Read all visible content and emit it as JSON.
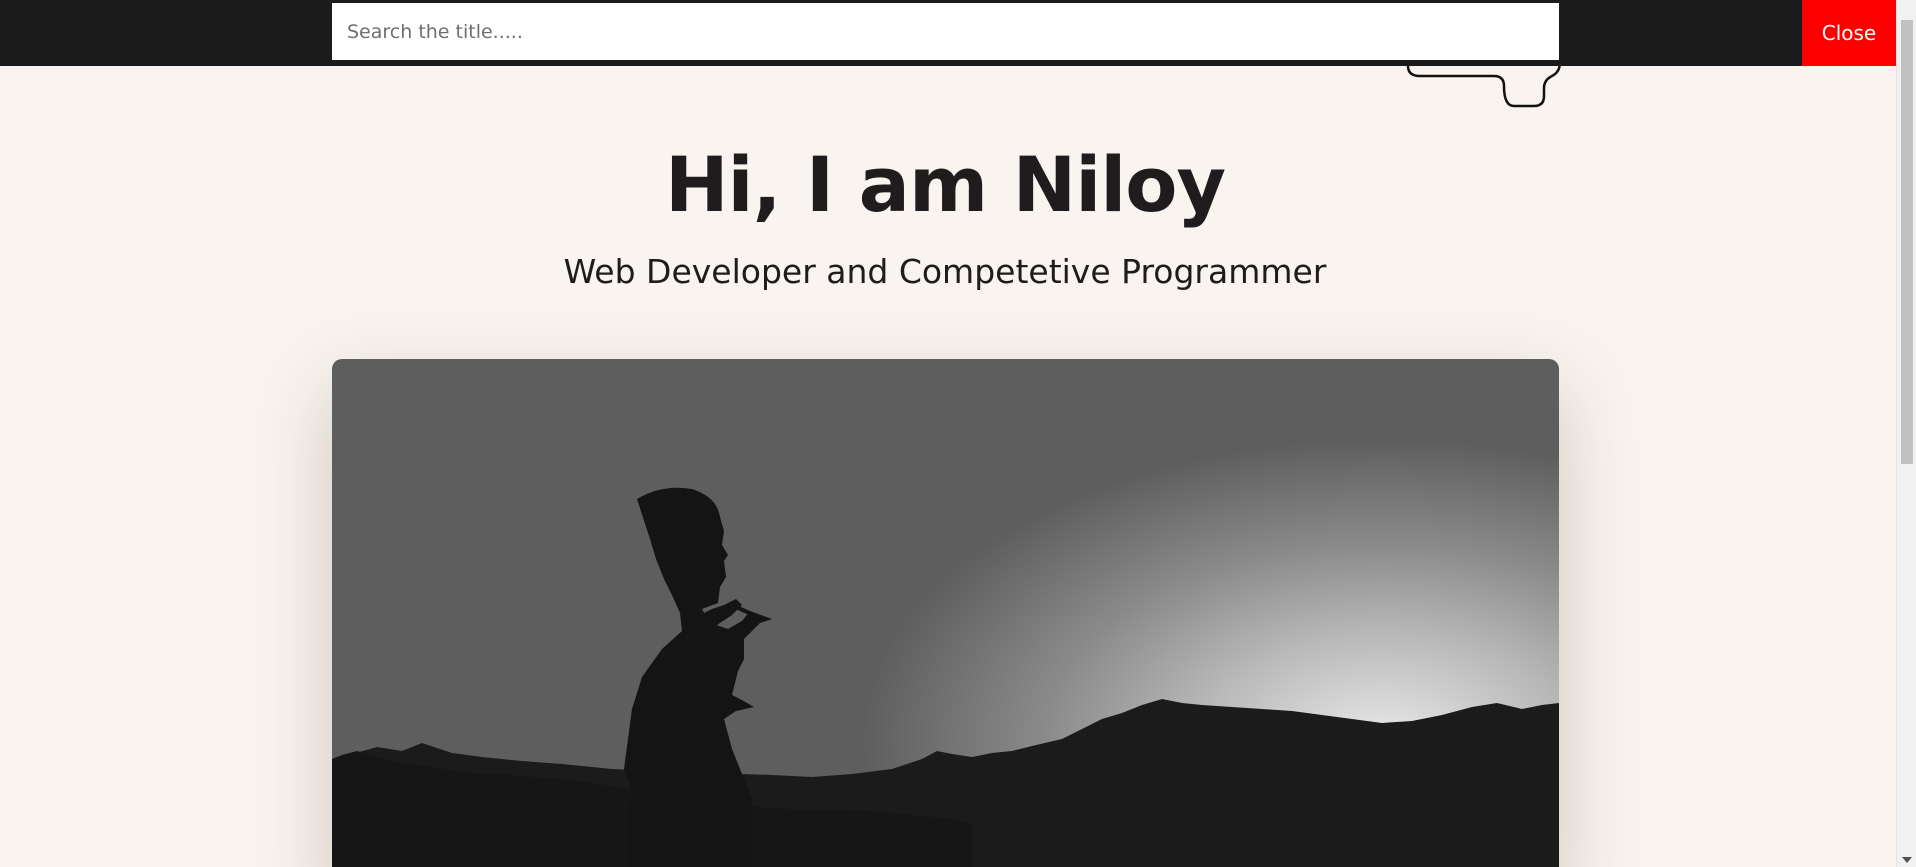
{
  "search": {
    "placeholder": "Search the title.....",
    "value": "",
    "close_label": "Close"
  },
  "hero": {
    "title": "Hi, I am Niloy",
    "subtitle": "Web Developer and Competetive Programmer",
    "image_icon": "silhouette-photo"
  },
  "colors": {
    "background": "#f9f4ef",
    "bar": "#1c1b1b",
    "close_button": "#ff0000",
    "text": "#1e1c1c"
  }
}
